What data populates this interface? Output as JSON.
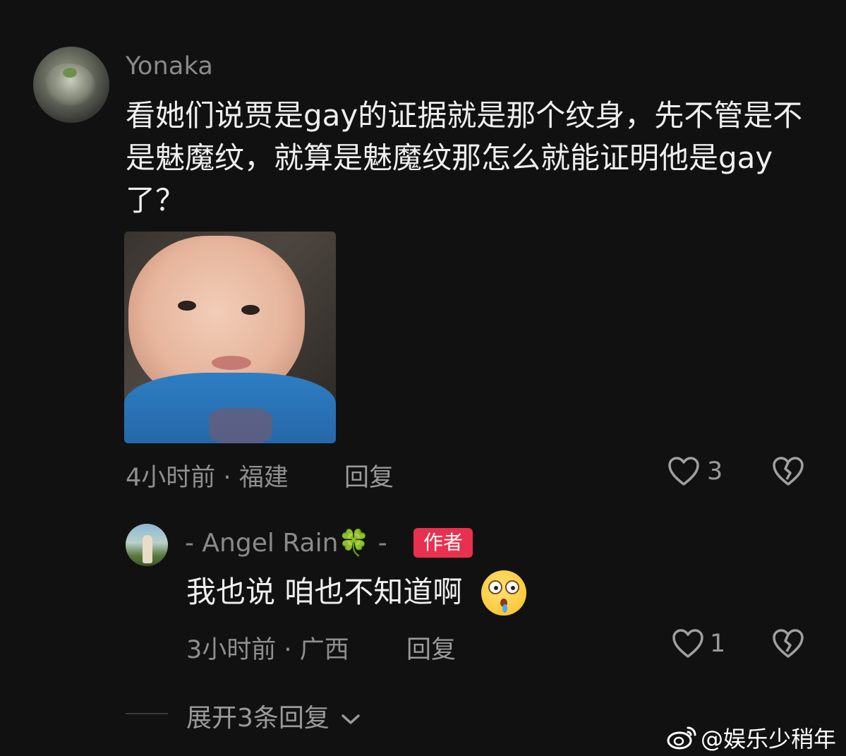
{
  "comment": {
    "username": "Yonaka",
    "text": "看她们说贾是gay的证据就是那个纹身，先不管是不是魅魔纹，就算是魅魔纹那怎么就能证明他是gay了？",
    "time": "4小时前",
    "location": "福建",
    "reply_label": "回复",
    "like_count": "3"
  },
  "reply": {
    "username": "- Angel Rain🍀 -",
    "badge": "作者",
    "text": "我也说 咱也不知道啊",
    "time": "3小时前",
    "location": "广西",
    "reply_label": "回复",
    "like_count": "1"
  },
  "expand_label": "展开3条回复",
  "watermark": "@娱乐少稍年",
  "icons": {
    "like": "heart-outline-icon",
    "dislike": "broken-heart-icon",
    "expand": "chevron-down-icon",
    "weibo": "weibo-logo-icon"
  },
  "colors": {
    "background": "#111111",
    "author_badge": "#e8314f"
  }
}
